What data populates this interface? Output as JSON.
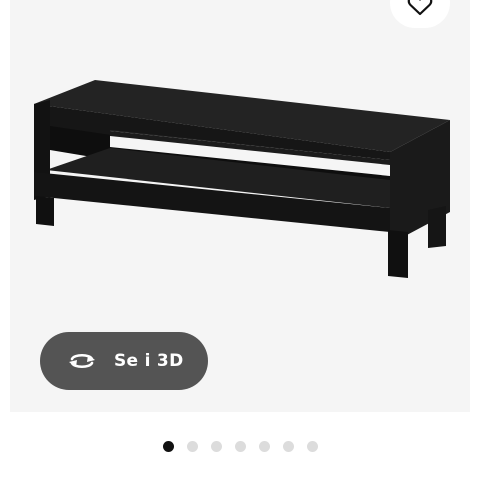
{
  "product_view": {
    "image_description": "black-tv-bench-image",
    "background_color": "#f5f5f5",
    "furniture_color": "#1c1c1c"
  },
  "favorite": {
    "icon": "heart-icon"
  },
  "view_3d": {
    "label": "Se i 3D",
    "icon": "rotate-3d-icon",
    "background_color": "#545454"
  },
  "carousel": {
    "total": 7,
    "active_index": 0,
    "active_color": "#111111",
    "inactive_color": "#dcdcdc"
  }
}
